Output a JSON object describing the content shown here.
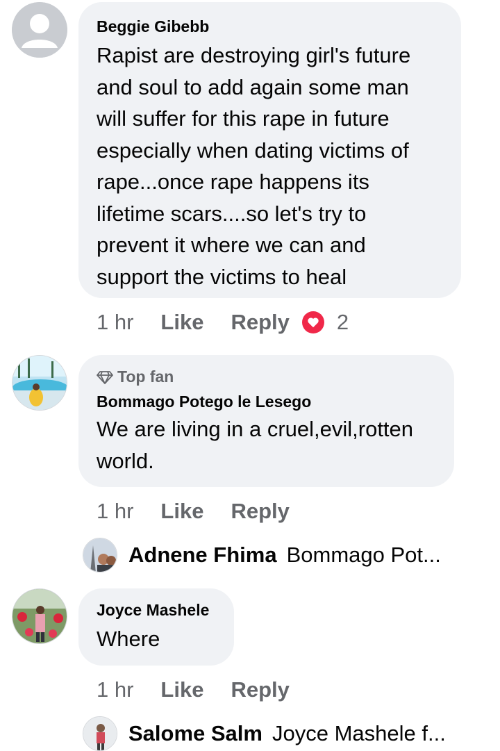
{
  "comments": [
    {
      "author": "Beggie Gibebb",
      "lines": [
        "Rapist are destroying girl's future",
        "and soul to add again  some man",
        "will suffer for this rape in future",
        "especially when dating victims of",
        "rape...once rape happens its",
        "lifetime scars....so let's try to",
        "prevent it where we can and",
        "support the victims to heal"
      ],
      "time": "1 hr",
      "like_label": "Like",
      "reply_label": "Reply",
      "reaction_count": "2",
      "avatar_icon": "default-profile-icon"
    },
    {
      "badge": "Top fan",
      "author": "Bommago Potego le Lesego",
      "lines": [
        "We are living in a cruel,evil,rotten",
        "world."
      ],
      "time": "1 hr",
      "like_label": "Like",
      "reply_label": "Reply",
      "reply_preview": {
        "name": "Adnene Fhima",
        "text": "Bommago Pot..."
      }
    },
    {
      "author": "Joyce Mashele",
      "lines": [
        "Where"
      ],
      "time": "1 hr",
      "like_label": "Like",
      "reply_label": "Reply",
      "reply_preview": {
        "name": "Salome Salm",
        "text": "Joyce Mashele f..."
      }
    }
  ],
  "colors": {
    "bubble": "#f0f2f5",
    "meta_gray": "#65676b",
    "love_red": "#f02849"
  }
}
